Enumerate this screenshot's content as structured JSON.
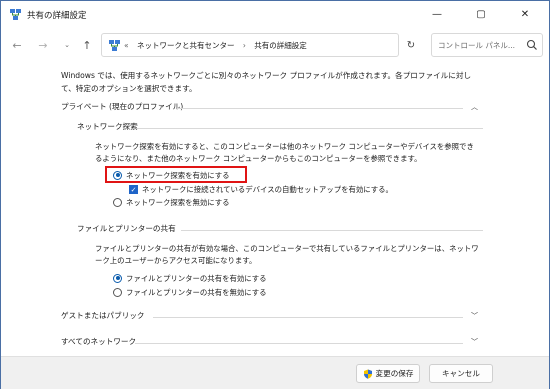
{
  "window": {
    "title": "共有の詳細設定",
    "controls": {
      "minimize": "—",
      "maximize": "▢",
      "close": "✕"
    }
  },
  "nav": {
    "back_glyph": "←",
    "forward_glyph": "→",
    "recent_glyph": "⌄",
    "up_glyph": "↑",
    "refresh_glyph": "↻",
    "breadcrumb": [
      "«",
      "ネットワークと共有センター",
      "›",
      "共有の詳細設定"
    ],
    "dropdown_glyph": "⌄",
    "search_placeholder": "コントロール パネル..."
  },
  "intro": "Windows では、使用するネットワークごとに別々のネットワーク プロファイルが作成されます。各プロファイルに対して、特定のオプションを選択できます。",
  "sections": {
    "private": {
      "label": "プライベート (現在のプロファイル)",
      "chevron": "︿",
      "network_discovery": {
        "label": "ネットワーク探索",
        "description": "ネットワーク探索を有効にすると、このコンピューターは他のネットワーク コンピューターやデバイスを参照できるようになり、また他のネットワーク コンピューターからもこのコンピューターを参照できます。",
        "option_on": "ネットワーク探索を有効にする",
        "auto_setup": "ネットワークに接続されているデバイスの自動セットアップを有効にする。",
        "option_off": "ネットワーク探索を無効にする"
      },
      "file_printer": {
        "label": "ファイルとプリンターの共有",
        "description": "ファイルとプリンターの共有が有効な場合、このコンピューターで共有しているファイルとプリンターは、ネットワーク上のユーザーからアクセス可能になります。",
        "option_on": "ファイルとプリンターの共有を有効にする",
        "option_off": "ファイルとプリンターの共有を無効にする"
      }
    },
    "guest": {
      "label": "ゲストまたはパブリック",
      "chevron": "﹀"
    },
    "all": {
      "label": "すべてのネットワーク",
      "chevron": "﹀"
    }
  },
  "footer": {
    "save_label": "変更の保存",
    "cancel_label": "キャンセル"
  },
  "colors": {
    "accent": "#0b5cad",
    "highlight_box": "#e01414",
    "checkbox": "#1e64c8"
  }
}
